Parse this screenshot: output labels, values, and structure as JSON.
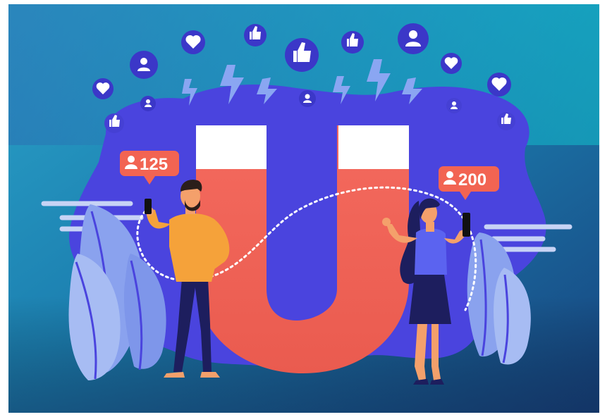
{
  "illustration": {
    "badge_left": {
      "count": "125",
      "icon": "user-icon"
    },
    "badge_right": {
      "count": "200",
      "icon": "user-icon"
    },
    "floating_icons": [
      "heart-icon",
      "user-icon",
      "thumbs-up-icon",
      "lightning-icon"
    ],
    "colors": {
      "background_top": "#12b3c8",
      "background_bottom": "#184a8a",
      "blob": "#4a46e0",
      "magnet": "#f0675c",
      "magnet_tips": "#ffffff",
      "badge": "#f26452",
      "icon_circle": "#3b37c8",
      "man_shirt": "#f5a23a",
      "woman_top": "#5b63f0",
      "pants": "#1d1e5e",
      "leaves": "#8ea6f0"
    }
  }
}
